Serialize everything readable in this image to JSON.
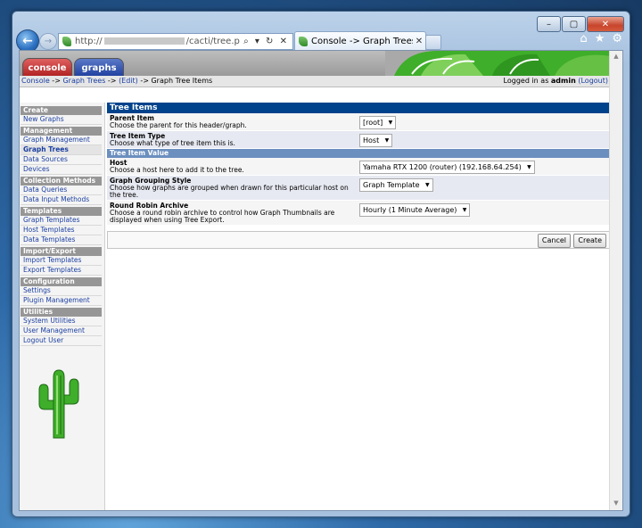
{
  "browser": {
    "address_visible": "http://",
    "address_path": "/cacti/tree.php?actior",
    "tab_title": "Console -> Graph Trees ...",
    "tab_close": "✕",
    "tools": "⌕ ▾ ↻ ✕",
    "caption": {
      "minimize": "–",
      "maximize": "▢",
      "close": "✕"
    },
    "icons": {
      "home": "⌂",
      "star": "★",
      "gear": "⚙"
    }
  },
  "cacti": {
    "tabs": {
      "console": "console",
      "graphs": "graphs"
    },
    "breadcrumb": {
      "console": "Console",
      "sep1": " -> ",
      "graph_trees": "Graph Trees",
      "sep2": " -> ",
      "edit": "(Edit)",
      "sep3": " -> ",
      "current": "Graph Tree Items"
    },
    "login": {
      "prefix": "Logged in as ",
      "user": "admin",
      "logout": "(Logout)"
    }
  },
  "sidebar": [
    {
      "header": "Create",
      "items": [
        "New Graphs"
      ]
    },
    {
      "header": "Management",
      "items": [
        "Graph Management",
        "Graph Trees",
        "Data Sources",
        "Devices"
      ]
    },
    {
      "header": "Collection Methods",
      "items": [
        "Data Queries",
        "Data Input Methods"
      ]
    },
    {
      "header": "Templates",
      "items": [
        "Graph Templates",
        "Host Templates",
        "Data Templates"
      ]
    },
    {
      "header": "Import/Export",
      "items": [
        "Import Templates",
        "Export Templates"
      ]
    },
    {
      "header": "Configuration",
      "items": [
        "Settings",
        "Plugin Management"
      ]
    },
    {
      "header": "Utilities",
      "items": [
        "System Utilities",
        "User Management",
        "Logout User"
      ]
    }
  ],
  "active_item": "Graph Trees",
  "form": {
    "title": "Tree Items",
    "rows1": [
      {
        "label": "Parent Item",
        "desc": "Choose the parent for this header/graph.",
        "value": "[root]"
      },
      {
        "label": "Tree Item Type",
        "desc": "Choose what type of tree item this is.",
        "value": "Host"
      }
    ],
    "section": "Tree Item Value",
    "rows2": [
      {
        "label": "Host",
        "desc": "Choose a host here to add it to the tree.",
        "value": "Yamaha RTX 1200 (router) (192.168.64.254)"
      },
      {
        "label": "Graph Grouping Style",
        "desc": "Choose how graphs are grouped when drawn for this particular host on the tree.",
        "value": "Graph Template"
      },
      {
        "label": "Round Robin Archive",
        "desc": "Choose a round robin archive to control how Graph Thumbnails are displayed when using Tree Export.",
        "value": "Hourly (1 Minute Average)"
      }
    ],
    "buttons": {
      "cancel": "Cancel",
      "create": "Create"
    }
  }
}
